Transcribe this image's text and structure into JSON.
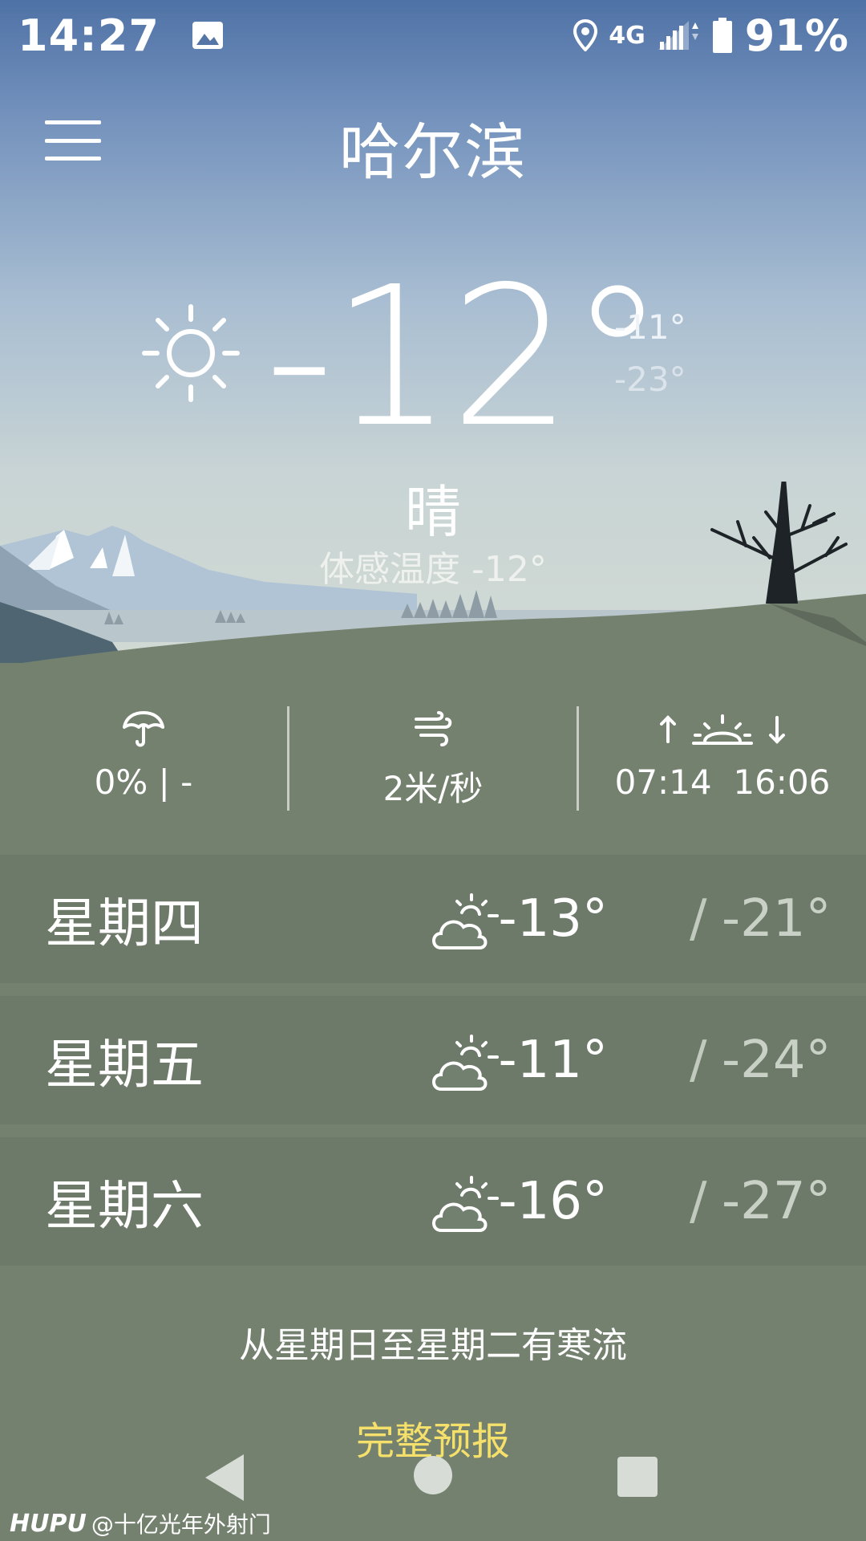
{
  "status_bar": {
    "time": "14:27",
    "network": "4G",
    "battery": "91%"
  },
  "header": {
    "city": "哈尔滨"
  },
  "current": {
    "temperature": "-12°",
    "high": "-11°",
    "low": "-23°",
    "condition": "晴",
    "feels_like": "体感温度 -12°"
  },
  "details": {
    "precipitation": "0% | -",
    "wind": "2米/秒",
    "sun_times": "07:14  16:06"
  },
  "forecast": [
    {
      "day": "星期四",
      "icon": "partly-cloudy-icon",
      "high": "-13°",
      "low": "-21°"
    },
    {
      "day": "星期五",
      "icon": "partly-cloudy-icon",
      "high": "-11°",
      "low": "-24°"
    },
    {
      "day": "星期六",
      "icon": "partly-cloudy-icon",
      "high": "-16°",
      "low": "-27°"
    }
  ],
  "separator": "/",
  "alert": "从星期日至星期二有寒流",
  "full_forecast_label": "完整预报",
  "watermark": {
    "logo": "HUPU",
    "user": "@十亿光年外射门"
  },
  "colors": {
    "ground": "#74816f",
    "row": "#6e7a69",
    "link": "#f4e06a"
  }
}
